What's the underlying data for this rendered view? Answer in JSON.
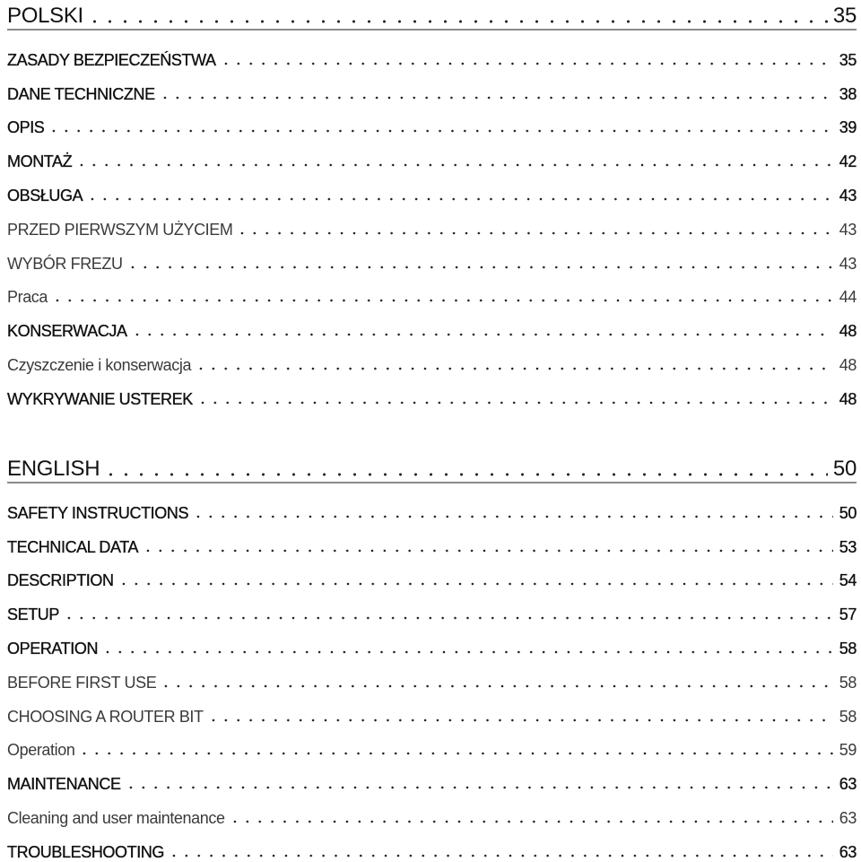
{
  "sections": [
    {
      "title": "POLSKI",
      "page": "35",
      "entries": [
        {
          "title": "ZASADY BEZPIECZEŃSTWA",
          "page": "35",
          "level": "main"
        },
        {
          "title": "DANE TECHNICZNE",
          "page": "38",
          "level": "main"
        },
        {
          "title": "OPIS",
          "page": "39",
          "level": "main"
        },
        {
          "title": "MONTAŻ",
          "page": "42",
          "level": "main"
        },
        {
          "title": "OBSŁUGA",
          "page": "43",
          "level": "main"
        },
        {
          "title": "PRZED PIERWSZYM UŻYCIEM",
          "page": "43",
          "level": "sub"
        },
        {
          "title": "WYBÓR FREZU",
          "page": "43",
          "level": "sub"
        },
        {
          "title": "Praca",
          "page": "44",
          "level": "sub"
        },
        {
          "title": "KONSERWACJA",
          "page": "48",
          "level": "main"
        },
        {
          "title": "Czyszczenie i konserwacja",
          "page": "48",
          "level": "sub"
        },
        {
          "title": "WYKRYWANIE USTEREK",
          "page": "48",
          "level": "main"
        }
      ]
    },
    {
      "title": "ENGLISH",
      "page": "50",
      "entries": [
        {
          "title": "SAFETY INSTRUCTIONS",
          "page": "50",
          "level": "main"
        },
        {
          "title": "TECHNICAL DATA",
          "page": "53",
          "level": "main"
        },
        {
          "title": "DESCRIPTION",
          "page": "54",
          "level": "main"
        },
        {
          "title": "SETUP",
          "page": "57",
          "level": "main"
        },
        {
          "title": "OPERATION",
          "page": "58",
          "level": "main"
        },
        {
          "title": "BEFORE FIRST USE",
          "page": "58",
          "level": "sub"
        },
        {
          "title": "CHOOSING A ROUTER BIT",
          "page": "58",
          "level": "sub"
        },
        {
          "title": "Operation",
          "page": "59",
          "level": "sub"
        },
        {
          "title": "MAINTENANCE",
          "page": "63",
          "level": "main"
        },
        {
          "title": "Cleaning and user maintenance",
          "page": "63",
          "level": "sub"
        },
        {
          "title": "TROUBLESHOOTING",
          "page": "63",
          "level": "main"
        }
      ]
    }
  ]
}
